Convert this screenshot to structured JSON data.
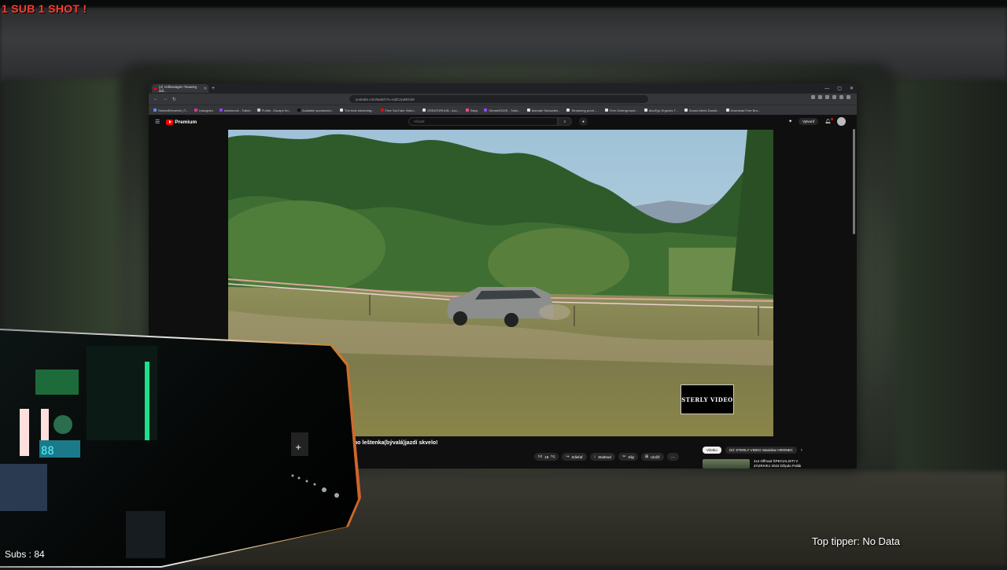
{
  "overlay": {
    "title": "1 SUB 1 SHOT !",
    "subs": "Subs : 84",
    "top_tipper": "Top tipper: No Data"
  },
  "browser": {
    "tab_title": "(4) Volkswagen Touareg dal...",
    "url": "youtube.com/watch?v=vqlCzyuBGxM",
    "bookmarks": [
      "StreamElements | T...",
      "Instagram",
      "twisdorock - Twitch",
      "Profile - Escape fro...",
      "Available sponsorshi...",
      "The best streaming...",
      "Free YouTube Video...",
      "CREATORHUB - Acc...",
      "Banp",
      "StreamEDGE - Twitc...",
      "Animate Subscribe...",
      "Streaming proof -...",
      "Free Underground...",
      "AlcoEgo Ergovirs T...",
      "Sound Alerts Dashb...",
      "Download Free Bro..."
    ]
  },
  "youtube": {
    "logo_text": "Premium",
    "search_placeholder": "Hľadať",
    "create_label": "Vytvoriť",
    "watermark": "STERLY VIDEO",
    "video_title": "ého leštenka(bývalá)jazdí skvelo!",
    "actions": {
      "likes": "19",
      "share": "Zdieľať",
      "download": "Stiahnuť",
      "clip": "Klip",
      "save": "Uložiť"
    },
    "chips": {
      "all": "Všetko",
      "channel": "Od: STERLY VIDEO Stanislav HRONEC"
    },
    "rec_title": "4x4 Offroad ŠPECIALISTI V ZÁZRIVEJ 2023 Džipdo Polák"
  },
  "colors": {
    "overlay_red": "#ff3b2f",
    "yt_red": "#ff0000",
    "yt_bg": "#0f0f0f"
  }
}
